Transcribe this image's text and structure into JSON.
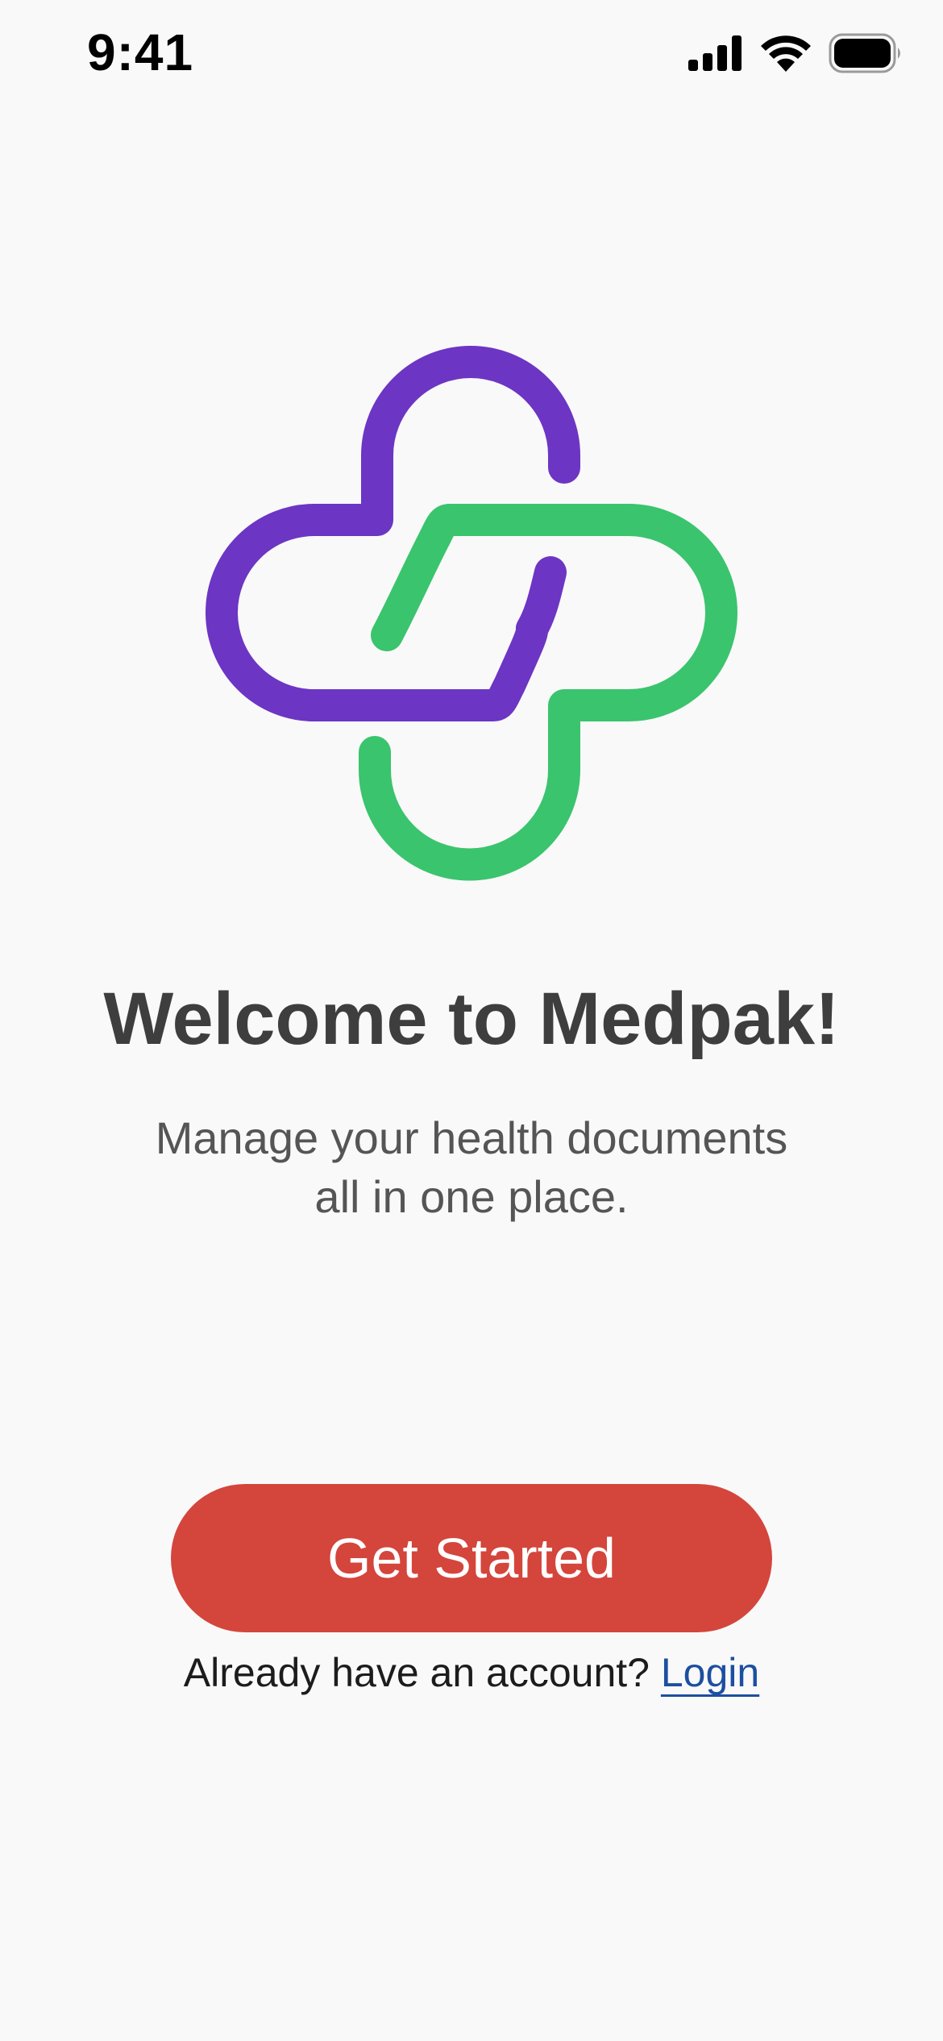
{
  "status_bar": {
    "time": "9:41",
    "icons": [
      "cellular-signal-icon",
      "wifi-icon",
      "battery-icon"
    ]
  },
  "logo": {
    "name": "medpak-cross-logo",
    "colors": {
      "purple": "#6c35c4",
      "green": "#3ac46d"
    }
  },
  "welcome": {
    "title": "Welcome to Medpak!",
    "subtitle": "Manage your health documents all in one place."
  },
  "actions": {
    "get_started_label": "Get Started",
    "account_prompt": "Already have an account?",
    "login_label": "Login"
  },
  "colors": {
    "background": "#f9f9f9",
    "primary_button": "#d4453c",
    "link": "#1d4fa0",
    "title_text": "#3e3e3e"
  }
}
